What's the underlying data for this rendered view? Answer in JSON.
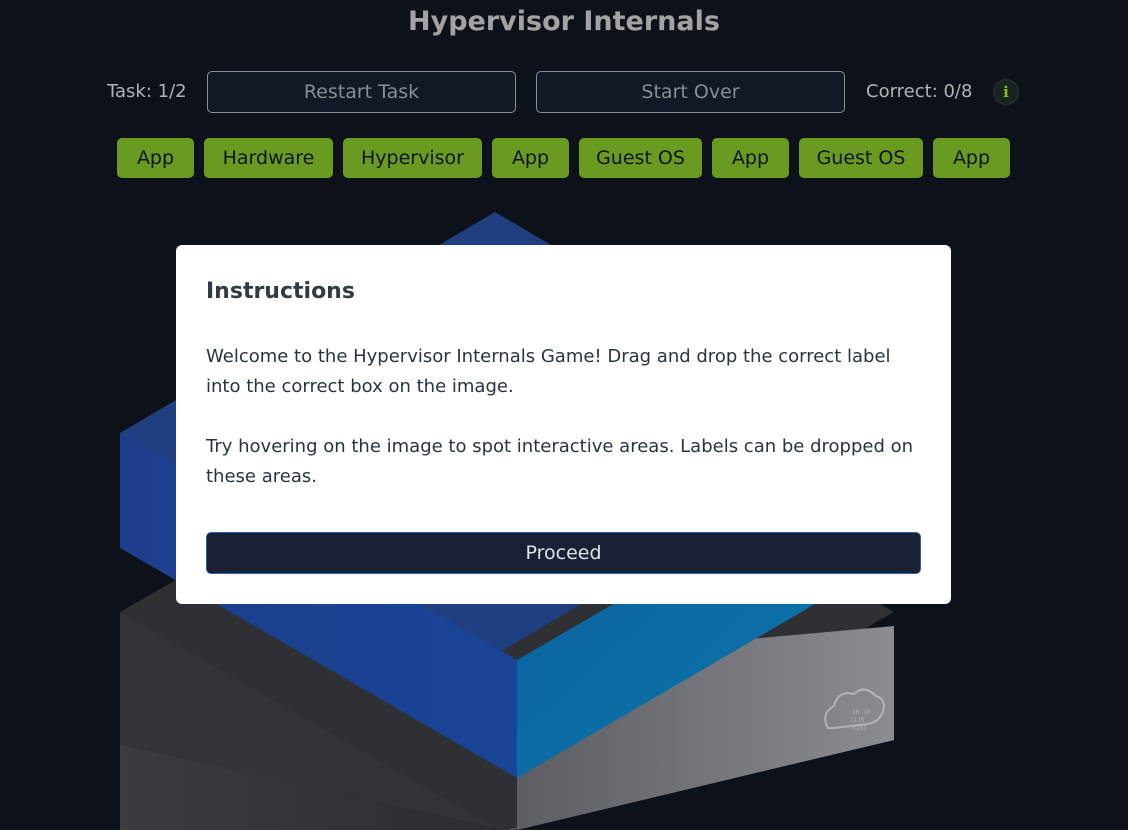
{
  "header": {
    "title": "Hypervisor Internals"
  },
  "controls": {
    "task_label": "Task: 1/2",
    "restart_label": "Restart Task",
    "start_over_label": "Start Over",
    "correct_label": "Correct: 0/8",
    "info_icon": "i"
  },
  "labels": [
    "App",
    "Hardware",
    "Hypervisor",
    "App",
    "Guest OS",
    "App",
    "Guest OS",
    "App"
  ],
  "modal": {
    "title": "Instructions",
    "paragraph1": "Welcome to the Hypervisor Internals Game! Drag and drop the correct label into the correct box on the image.",
    "paragraph2": "Try hovering on the image to spot interactive areas. Labels can be dropped on these areas.",
    "proceed_label": "Proceed"
  },
  "colors": {
    "background": "#0d111a",
    "label_chip": "#6a9a1f",
    "accent_green": "#7fc31c",
    "modal_bg": "#ffffff",
    "proceed_bg": "#1a2134"
  }
}
